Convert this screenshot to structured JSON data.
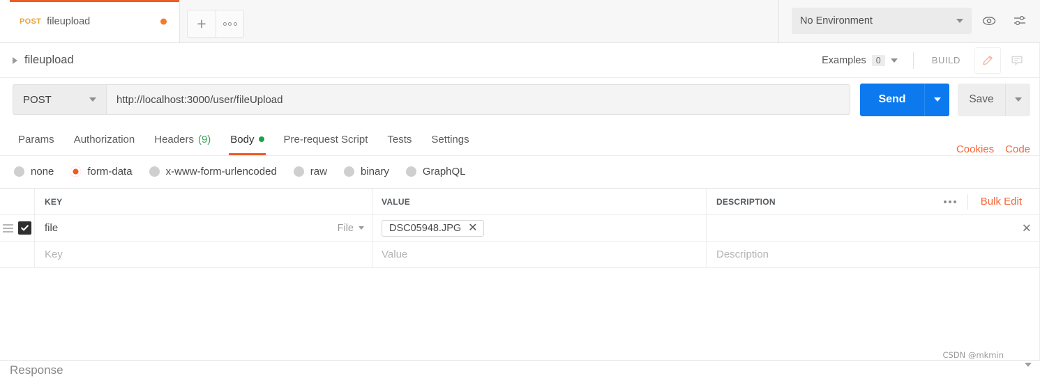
{
  "tab": {
    "method": "POST",
    "title": "fileupload",
    "unsaved_dot": "unsaved",
    "new_tab_icon": "plus-icon",
    "tab_menu_icon": "three-circles-icon"
  },
  "environment": {
    "selected": "No Environment",
    "eye_icon": "eye-icon",
    "settings_icon": "sliders-icon"
  },
  "breadcrumb": {
    "expand_icon": "triangle-right-icon",
    "title": "fileupload",
    "examples_label": "Examples",
    "examples_count": "0",
    "build_label": "BUILD",
    "edit_icon": "pencil-icon",
    "comment_icon": "comment-icon"
  },
  "request": {
    "method": "POST",
    "url": "http://localhost:3000/user/fileUpload",
    "send_label": "Send",
    "save_label": "Save"
  },
  "request_tabs": [
    {
      "label": "Params",
      "active": false
    },
    {
      "label": "Authorization",
      "active": false
    },
    {
      "label": "Headers",
      "count": "(9)",
      "active": false
    },
    {
      "label": "Body",
      "active": true,
      "dot": true
    },
    {
      "label": "Pre-request Script",
      "active": false
    },
    {
      "label": "Tests",
      "active": false
    },
    {
      "label": "Settings",
      "active": false
    }
  ],
  "request_tabs_right": {
    "cookies": "Cookies",
    "code": "Code"
  },
  "body_modes": [
    {
      "label": "none",
      "selected": false
    },
    {
      "label": "form-data",
      "selected": true
    },
    {
      "label": "x-www-form-urlencoded",
      "selected": false
    },
    {
      "label": "raw",
      "selected": false
    },
    {
      "label": "binary",
      "selected": false
    },
    {
      "label": "GraphQL",
      "selected": false
    }
  ],
  "kv_table": {
    "headers": {
      "key": "KEY",
      "value": "VALUE",
      "description": "DESCRIPTION",
      "menu_icon": "three-dots-icon",
      "bulk_edit": "Bulk Edit"
    },
    "rows": [
      {
        "checked": true,
        "key": "file",
        "type": "File",
        "file_name": "DSC05948.JPG",
        "description": "",
        "remove_icon": "close-icon"
      }
    ],
    "empty_row": {
      "key_placeholder": "Key",
      "value_placeholder": "Value",
      "description_placeholder": "Description"
    }
  },
  "response": {
    "title": "Response"
  },
  "watermark": "CSDN @mkmin",
  "colors": {
    "accent_orange": "#ef5b25",
    "link_orange": "#f4663a",
    "send_blue": "#0c79ef",
    "method_amber": "#e8a33d",
    "green": "#1aa24a"
  }
}
